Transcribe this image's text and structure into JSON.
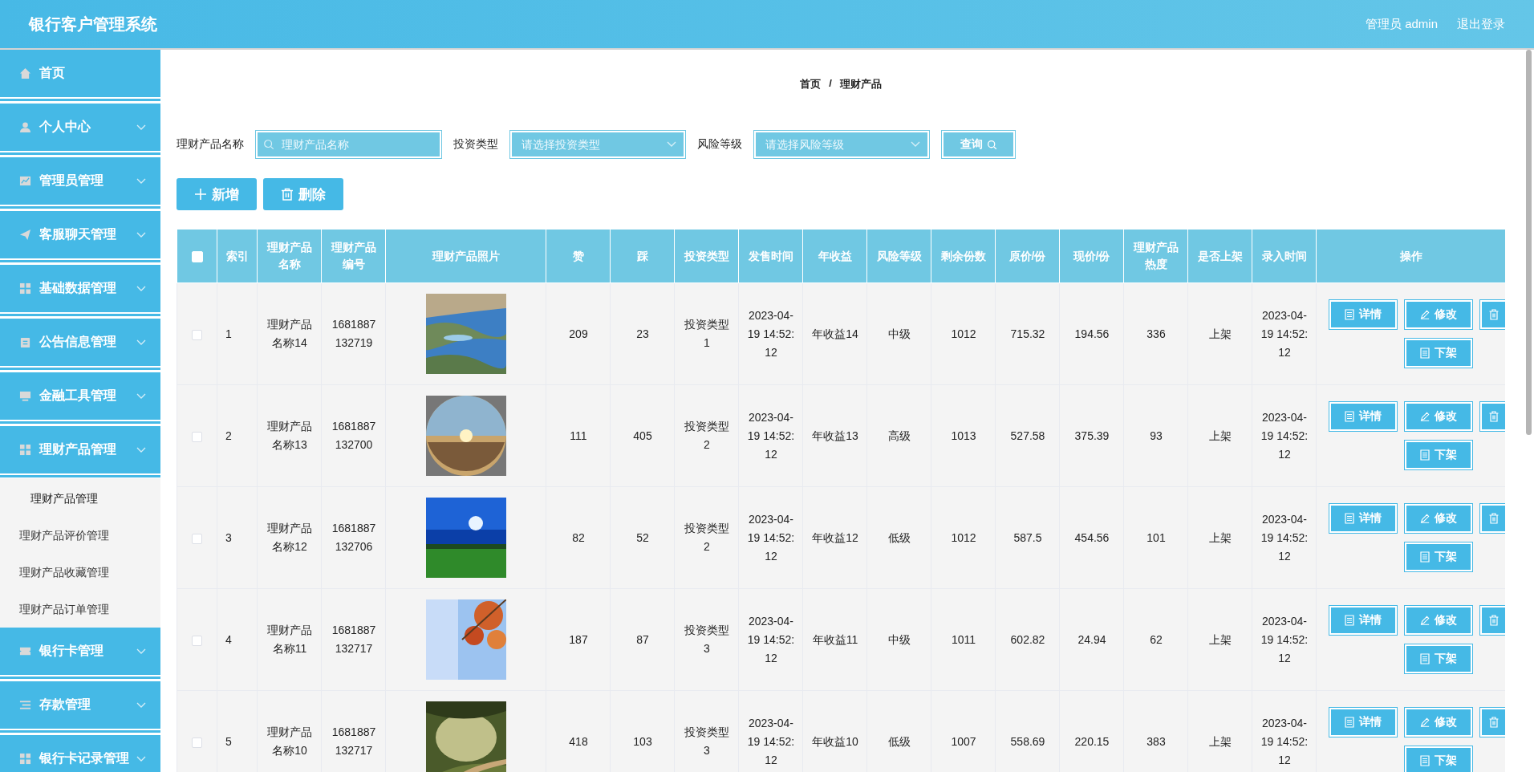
{
  "header": {
    "title": "银行客户管理系统",
    "user": "管理员 admin",
    "logout": "退出登录"
  },
  "sidebar": {
    "items": [
      {
        "label": "首页"
      },
      {
        "label": "个人中心"
      },
      {
        "label": "管理员管理"
      },
      {
        "label": "客服聊天管理"
      },
      {
        "label": "基础数据管理"
      },
      {
        "label": "公告信息管理"
      },
      {
        "label": "金融工具管理"
      },
      {
        "label": "理财产品管理",
        "children": [
          {
            "label": "理财产品管理",
            "selected": true
          },
          {
            "label": "理财产品评价管理",
            "selected": false
          },
          {
            "label": "理财产品收藏管理",
            "selected": false
          },
          {
            "label": "理财产品订单管理",
            "selected": false
          }
        ]
      },
      {
        "label": "银行卡管理"
      },
      {
        "label": "存款管理"
      },
      {
        "label": "银行卡记录管理"
      }
    ]
  },
  "breadcrumb": {
    "items": [
      "首页",
      "理财产品"
    ],
    "separator": "/"
  },
  "search": {
    "fields": [
      {
        "label": "理财产品名称",
        "placeholder": "理财产品名称",
        "kind": "input"
      },
      {
        "label": "投资类型",
        "placeholder": "请选择投资类型",
        "kind": "select"
      },
      {
        "label": "风险等级",
        "placeholder": "请选择风险等级",
        "kind": "select"
      }
    ],
    "button": "查询"
  },
  "actions": [
    {
      "label": "新增",
      "kind": "add"
    },
    {
      "label": "删除",
      "kind": "delete"
    }
  ],
  "table": {
    "select_all": {
      "checked": false
    },
    "columns": [
      "索引",
      "理财产品名称",
      "理财产品编号",
      "理财产品照片",
      "赞",
      "踩",
      "投资类型",
      "发售时间",
      "年收益",
      "风险等级",
      "剩余份数",
      "原价/份",
      "现价/份",
      "理财产品热度",
      "是否上架",
      "录入时间",
      "操作"
    ],
    "rows": [
      {
        "checked": false,
        "cells": [
          "1",
          "理财产品名称14",
          "1681887132719",
          {
            "kind": "picture"
          },
          "209",
          "23",
          "投资类型1",
          "2023-04-19 14:52:12",
          "年收益14",
          "中级",
          "1012",
          "715.32",
          "194.56",
          "336",
          "上架",
          "2023-04-19 14:52:12"
        ],
        "buttons": [
          {
            "label": "详情",
            "kind": "detail"
          },
          {
            "label": "修改",
            "kind": "edit"
          },
          {
            "kind": "delete"
          },
          {
            "label": "下架",
            "kind": "unlist"
          }
        ]
      },
      {
        "checked": false,
        "cells": [
          "2",
          "理财产品名称13",
          "1681887132700",
          {
            "kind": "picture"
          },
          "111",
          "405",
          "投资类型2",
          "2023-04-19 14:52:12",
          "年收益13",
          "高级",
          "1013",
          "527.58",
          "375.39",
          "93",
          "上架",
          "2023-04-19 14:52:12"
        ],
        "buttons": [
          {
            "label": "详情",
            "kind": "detail"
          },
          {
            "label": "修改",
            "kind": "edit"
          },
          {
            "kind": "delete"
          },
          {
            "label": "下架",
            "kind": "unlist"
          }
        ]
      },
      {
        "checked": false,
        "cells": [
          "3",
          "理财产品名称12",
          "1681887132706",
          {
            "kind": "picture"
          },
          "82",
          "52",
          "投资类型2",
          "2023-04-19 14:52:12",
          "年收益12",
          "低级",
          "1012",
          "587.5",
          "454.56",
          "101",
          "上架",
          "2023-04-19 14:52:12"
        ],
        "buttons": [
          {
            "label": "详情",
            "kind": "detail"
          },
          {
            "label": "修改",
            "kind": "edit"
          },
          {
            "kind": "delete"
          },
          {
            "label": "下架",
            "kind": "unlist"
          }
        ]
      },
      {
        "checked": false,
        "cells": [
          "4",
          "理财产品名称11",
          "1681887132717",
          {
            "kind": "picture"
          },
          "187",
          "87",
          "投资类型3",
          "2023-04-19 14:52:12",
          "年收益11",
          "中级",
          "1011",
          "602.82",
          "24.94",
          "62",
          "上架",
          "2023-04-19 14:52:12"
        ],
        "buttons": [
          {
            "label": "详情",
            "kind": "detail"
          },
          {
            "label": "修改",
            "kind": "edit"
          },
          {
            "kind": "delete"
          },
          {
            "label": "下架",
            "kind": "unlist"
          }
        ]
      },
      {
        "checked": false,
        "cells": [
          "5",
          "理财产品名称10",
          "1681887132717",
          {
            "kind": "picture"
          },
          "418",
          "103",
          "投资类型3",
          "2023-04-19 14:52:12",
          "年收益10",
          "低级",
          "1007",
          "558.69",
          "220.15",
          "383",
          "上架",
          "2023-04-19 14:52:12"
        ],
        "buttons": [
          {
            "label": "详情",
            "kind": "detail"
          },
          {
            "label": "修改",
            "kind": "edit"
          },
          {
            "kind": "delete"
          },
          {
            "label": "下架",
            "kind": "unlist"
          }
        ]
      }
    ]
  }
}
